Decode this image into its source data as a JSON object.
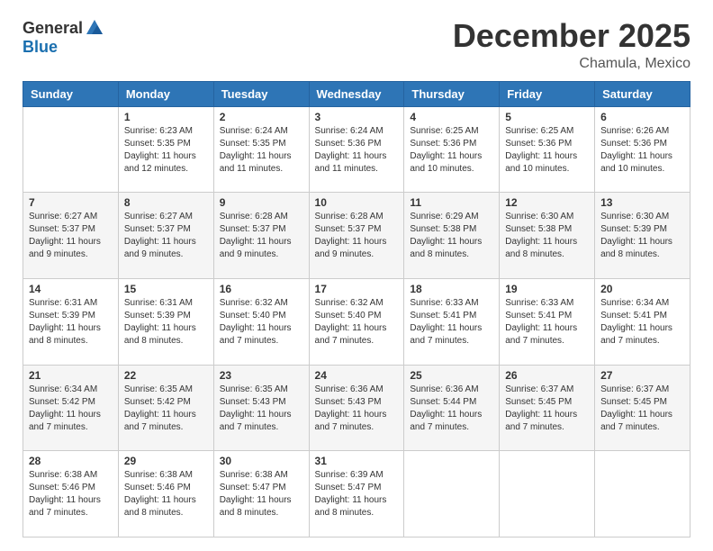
{
  "header": {
    "logo_general": "General",
    "logo_blue": "Blue",
    "month_title": "December 2025",
    "location": "Chamula, Mexico"
  },
  "days_of_week": [
    "Sunday",
    "Monday",
    "Tuesday",
    "Wednesday",
    "Thursday",
    "Friday",
    "Saturday"
  ],
  "weeks": [
    [
      {
        "day": "",
        "sunrise": "",
        "sunset": "",
        "daylight": ""
      },
      {
        "day": "1",
        "sunrise": "Sunrise: 6:23 AM",
        "sunset": "Sunset: 5:35 PM",
        "daylight": "Daylight: 11 hours and 12 minutes."
      },
      {
        "day": "2",
        "sunrise": "Sunrise: 6:24 AM",
        "sunset": "Sunset: 5:35 PM",
        "daylight": "Daylight: 11 hours and 11 minutes."
      },
      {
        "day": "3",
        "sunrise": "Sunrise: 6:24 AM",
        "sunset": "Sunset: 5:36 PM",
        "daylight": "Daylight: 11 hours and 11 minutes."
      },
      {
        "day": "4",
        "sunrise": "Sunrise: 6:25 AM",
        "sunset": "Sunset: 5:36 PM",
        "daylight": "Daylight: 11 hours and 10 minutes."
      },
      {
        "day": "5",
        "sunrise": "Sunrise: 6:25 AM",
        "sunset": "Sunset: 5:36 PM",
        "daylight": "Daylight: 11 hours and 10 minutes."
      },
      {
        "day": "6",
        "sunrise": "Sunrise: 6:26 AM",
        "sunset": "Sunset: 5:36 PM",
        "daylight": "Daylight: 11 hours and 10 minutes."
      }
    ],
    [
      {
        "day": "7",
        "sunrise": "Sunrise: 6:27 AM",
        "sunset": "Sunset: 5:37 PM",
        "daylight": "Daylight: 11 hours and 9 minutes."
      },
      {
        "day": "8",
        "sunrise": "Sunrise: 6:27 AM",
        "sunset": "Sunset: 5:37 PM",
        "daylight": "Daylight: 11 hours and 9 minutes."
      },
      {
        "day": "9",
        "sunrise": "Sunrise: 6:28 AM",
        "sunset": "Sunset: 5:37 PM",
        "daylight": "Daylight: 11 hours and 9 minutes."
      },
      {
        "day": "10",
        "sunrise": "Sunrise: 6:28 AM",
        "sunset": "Sunset: 5:37 PM",
        "daylight": "Daylight: 11 hours and 9 minutes."
      },
      {
        "day": "11",
        "sunrise": "Sunrise: 6:29 AM",
        "sunset": "Sunset: 5:38 PM",
        "daylight": "Daylight: 11 hours and 8 minutes."
      },
      {
        "day": "12",
        "sunrise": "Sunrise: 6:30 AM",
        "sunset": "Sunset: 5:38 PM",
        "daylight": "Daylight: 11 hours and 8 minutes."
      },
      {
        "day": "13",
        "sunrise": "Sunrise: 6:30 AM",
        "sunset": "Sunset: 5:39 PM",
        "daylight": "Daylight: 11 hours and 8 minutes."
      }
    ],
    [
      {
        "day": "14",
        "sunrise": "Sunrise: 6:31 AM",
        "sunset": "Sunset: 5:39 PM",
        "daylight": "Daylight: 11 hours and 8 minutes."
      },
      {
        "day": "15",
        "sunrise": "Sunrise: 6:31 AM",
        "sunset": "Sunset: 5:39 PM",
        "daylight": "Daylight: 11 hours and 8 minutes."
      },
      {
        "day": "16",
        "sunrise": "Sunrise: 6:32 AM",
        "sunset": "Sunset: 5:40 PM",
        "daylight": "Daylight: 11 hours and 7 minutes."
      },
      {
        "day": "17",
        "sunrise": "Sunrise: 6:32 AM",
        "sunset": "Sunset: 5:40 PM",
        "daylight": "Daylight: 11 hours and 7 minutes."
      },
      {
        "day": "18",
        "sunrise": "Sunrise: 6:33 AM",
        "sunset": "Sunset: 5:41 PM",
        "daylight": "Daylight: 11 hours and 7 minutes."
      },
      {
        "day": "19",
        "sunrise": "Sunrise: 6:33 AM",
        "sunset": "Sunset: 5:41 PM",
        "daylight": "Daylight: 11 hours and 7 minutes."
      },
      {
        "day": "20",
        "sunrise": "Sunrise: 6:34 AM",
        "sunset": "Sunset: 5:41 PM",
        "daylight": "Daylight: 11 hours and 7 minutes."
      }
    ],
    [
      {
        "day": "21",
        "sunrise": "Sunrise: 6:34 AM",
        "sunset": "Sunset: 5:42 PM",
        "daylight": "Daylight: 11 hours and 7 minutes."
      },
      {
        "day": "22",
        "sunrise": "Sunrise: 6:35 AM",
        "sunset": "Sunset: 5:42 PM",
        "daylight": "Daylight: 11 hours and 7 minutes."
      },
      {
        "day": "23",
        "sunrise": "Sunrise: 6:35 AM",
        "sunset": "Sunset: 5:43 PM",
        "daylight": "Daylight: 11 hours and 7 minutes."
      },
      {
        "day": "24",
        "sunrise": "Sunrise: 6:36 AM",
        "sunset": "Sunset: 5:43 PM",
        "daylight": "Daylight: 11 hours and 7 minutes."
      },
      {
        "day": "25",
        "sunrise": "Sunrise: 6:36 AM",
        "sunset": "Sunset: 5:44 PM",
        "daylight": "Daylight: 11 hours and 7 minutes."
      },
      {
        "day": "26",
        "sunrise": "Sunrise: 6:37 AM",
        "sunset": "Sunset: 5:45 PM",
        "daylight": "Daylight: 11 hours and 7 minutes."
      },
      {
        "day": "27",
        "sunrise": "Sunrise: 6:37 AM",
        "sunset": "Sunset: 5:45 PM",
        "daylight": "Daylight: 11 hours and 7 minutes."
      }
    ],
    [
      {
        "day": "28",
        "sunrise": "Sunrise: 6:38 AM",
        "sunset": "Sunset: 5:46 PM",
        "daylight": "Daylight: 11 hours and 7 minutes."
      },
      {
        "day": "29",
        "sunrise": "Sunrise: 6:38 AM",
        "sunset": "Sunset: 5:46 PM",
        "daylight": "Daylight: 11 hours and 8 minutes."
      },
      {
        "day": "30",
        "sunrise": "Sunrise: 6:38 AM",
        "sunset": "Sunset: 5:47 PM",
        "daylight": "Daylight: 11 hours and 8 minutes."
      },
      {
        "day": "31",
        "sunrise": "Sunrise: 6:39 AM",
        "sunset": "Sunset: 5:47 PM",
        "daylight": "Daylight: 11 hours and 8 minutes."
      },
      {
        "day": "",
        "sunrise": "",
        "sunset": "",
        "daylight": ""
      },
      {
        "day": "",
        "sunrise": "",
        "sunset": "",
        "daylight": ""
      },
      {
        "day": "",
        "sunrise": "",
        "sunset": "",
        "daylight": ""
      }
    ]
  ]
}
